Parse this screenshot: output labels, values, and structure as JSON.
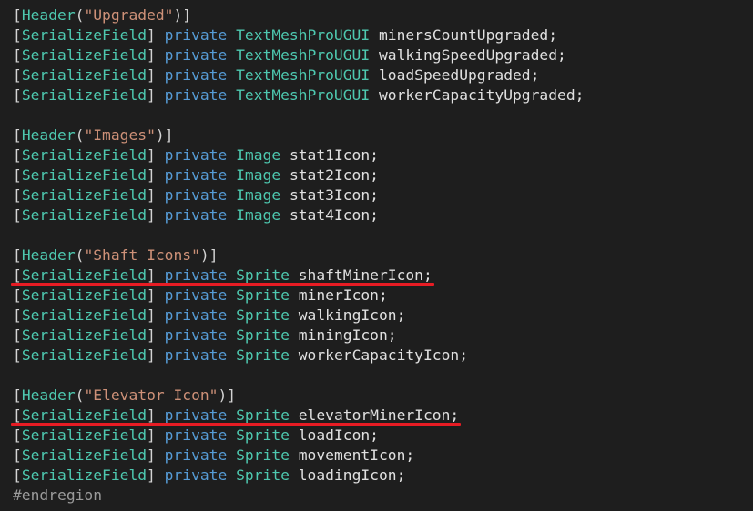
{
  "colors": {
    "background": "#1e1e1e",
    "bracket": "#d4d4d4",
    "attribute": "#4ec9b0",
    "string": "#ce9178",
    "keyword": "#569cd6",
    "type": "#4ec9b0",
    "identifier": "#e0e0e0",
    "preprocessor": "#9b9b9b",
    "underline": "#e81c24"
  },
  "lines": [
    {
      "tokens": [
        [
          "bracket",
          "["
        ],
        [
          "attribute",
          "Header"
        ],
        [
          "bracket",
          "("
        ],
        [
          "string",
          "\"Upgraded\""
        ],
        [
          "bracket",
          ")]"
        ]
      ]
    },
    {
      "tokens": [
        [
          "bracket",
          "["
        ],
        [
          "attribute",
          "SerializeField"
        ],
        [
          "bracket",
          "]"
        ],
        [
          "plain",
          " "
        ],
        [
          "keyword",
          "private"
        ],
        [
          "plain",
          " "
        ],
        [
          "type",
          "TextMeshProUGUI"
        ],
        [
          "plain",
          " "
        ],
        [
          "identifier",
          "minersCountUpgraded;"
        ]
      ]
    },
    {
      "tokens": [
        [
          "bracket",
          "["
        ],
        [
          "attribute",
          "SerializeField"
        ],
        [
          "bracket",
          "]"
        ],
        [
          "plain",
          " "
        ],
        [
          "keyword",
          "private"
        ],
        [
          "plain",
          " "
        ],
        [
          "type",
          "TextMeshProUGUI"
        ],
        [
          "plain",
          " "
        ],
        [
          "identifier",
          "walkingSpeedUpgraded;"
        ]
      ]
    },
    {
      "tokens": [
        [
          "bracket",
          "["
        ],
        [
          "attribute",
          "SerializeField"
        ],
        [
          "bracket",
          "]"
        ],
        [
          "plain",
          " "
        ],
        [
          "keyword",
          "private"
        ],
        [
          "plain",
          " "
        ],
        [
          "type",
          "TextMeshProUGUI"
        ],
        [
          "plain",
          " "
        ],
        [
          "identifier",
          "loadSpeedUpgraded;"
        ]
      ]
    },
    {
      "tokens": [
        [
          "bracket",
          "["
        ],
        [
          "attribute",
          "SerializeField"
        ],
        [
          "bracket",
          "]"
        ],
        [
          "plain",
          " "
        ],
        [
          "keyword",
          "private"
        ],
        [
          "plain",
          " "
        ],
        [
          "type",
          "TextMeshProUGUI"
        ],
        [
          "plain",
          " "
        ],
        [
          "identifier",
          "workerCapacityUpgraded;"
        ]
      ]
    },
    {
      "tokens": []
    },
    {
      "tokens": [
        [
          "bracket",
          "["
        ],
        [
          "attribute",
          "Header"
        ],
        [
          "bracket",
          "("
        ],
        [
          "string",
          "\"Images\""
        ],
        [
          "bracket",
          ")]"
        ]
      ]
    },
    {
      "tokens": [
        [
          "bracket",
          "["
        ],
        [
          "attribute",
          "SerializeField"
        ],
        [
          "bracket",
          "]"
        ],
        [
          "plain",
          " "
        ],
        [
          "keyword",
          "private"
        ],
        [
          "plain",
          " "
        ],
        [
          "type",
          "Image"
        ],
        [
          "plain",
          " "
        ],
        [
          "identifier",
          "stat1Icon;"
        ]
      ]
    },
    {
      "tokens": [
        [
          "bracket",
          "["
        ],
        [
          "attribute",
          "SerializeField"
        ],
        [
          "bracket",
          "]"
        ],
        [
          "plain",
          " "
        ],
        [
          "keyword",
          "private"
        ],
        [
          "plain",
          " "
        ],
        [
          "type",
          "Image"
        ],
        [
          "plain",
          " "
        ],
        [
          "identifier",
          "stat2Icon;"
        ]
      ]
    },
    {
      "tokens": [
        [
          "bracket",
          "["
        ],
        [
          "attribute",
          "SerializeField"
        ],
        [
          "bracket",
          "]"
        ],
        [
          "plain",
          " "
        ],
        [
          "keyword",
          "private"
        ],
        [
          "plain",
          " "
        ],
        [
          "type",
          "Image"
        ],
        [
          "plain",
          " "
        ],
        [
          "identifier",
          "stat3Icon;"
        ]
      ]
    },
    {
      "tokens": [
        [
          "bracket",
          "["
        ],
        [
          "attribute",
          "SerializeField"
        ],
        [
          "bracket",
          "]"
        ],
        [
          "plain",
          " "
        ],
        [
          "keyword",
          "private"
        ],
        [
          "plain",
          " "
        ],
        [
          "type",
          "Image"
        ],
        [
          "plain",
          " "
        ],
        [
          "identifier",
          "stat4Icon;"
        ]
      ]
    },
    {
      "tokens": []
    },
    {
      "tokens": [
        [
          "bracket",
          "["
        ],
        [
          "attribute",
          "Header"
        ],
        [
          "bracket",
          "("
        ],
        [
          "string",
          "\"Shaft Icons\""
        ],
        [
          "bracket",
          ")]"
        ]
      ]
    },
    {
      "tokens": [
        [
          "bracket",
          "["
        ],
        [
          "attribute",
          "SerializeField"
        ],
        [
          "bracket",
          "]"
        ],
        [
          "plain",
          " "
        ],
        [
          "keyword",
          "private"
        ],
        [
          "plain",
          " "
        ],
        [
          "type",
          "Sprite"
        ],
        [
          "plain",
          " "
        ],
        [
          "identifier",
          "shaftMinerIcon;"
        ]
      ],
      "underlined": true
    },
    {
      "tokens": [
        [
          "bracket",
          "["
        ],
        [
          "attribute",
          "SerializeField"
        ],
        [
          "bracket",
          "]"
        ],
        [
          "plain",
          " "
        ],
        [
          "keyword",
          "private"
        ],
        [
          "plain",
          " "
        ],
        [
          "type",
          "Sprite"
        ],
        [
          "plain",
          " "
        ],
        [
          "identifier",
          "minerIcon;"
        ]
      ]
    },
    {
      "tokens": [
        [
          "bracket",
          "["
        ],
        [
          "attribute",
          "SerializeField"
        ],
        [
          "bracket",
          "]"
        ],
        [
          "plain",
          " "
        ],
        [
          "keyword",
          "private"
        ],
        [
          "plain",
          " "
        ],
        [
          "type",
          "Sprite"
        ],
        [
          "plain",
          " "
        ],
        [
          "identifier",
          "walkingIcon;"
        ]
      ]
    },
    {
      "tokens": [
        [
          "bracket",
          "["
        ],
        [
          "attribute",
          "SerializeField"
        ],
        [
          "bracket",
          "]"
        ],
        [
          "plain",
          " "
        ],
        [
          "keyword",
          "private"
        ],
        [
          "plain",
          " "
        ],
        [
          "type",
          "Sprite"
        ],
        [
          "plain",
          " "
        ],
        [
          "identifier",
          "miningIcon;"
        ]
      ]
    },
    {
      "tokens": [
        [
          "bracket",
          "["
        ],
        [
          "attribute",
          "SerializeField"
        ],
        [
          "bracket",
          "]"
        ],
        [
          "plain",
          " "
        ],
        [
          "keyword",
          "private"
        ],
        [
          "plain",
          " "
        ],
        [
          "type",
          "Sprite"
        ],
        [
          "plain",
          " "
        ],
        [
          "identifier",
          "workerCapacityIcon;"
        ]
      ]
    },
    {
      "tokens": []
    },
    {
      "tokens": [
        [
          "bracket",
          "["
        ],
        [
          "attribute",
          "Header"
        ],
        [
          "bracket",
          "("
        ],
        [
          "string",
          "\"Elevator Icon\""
        ],
        [
          "bracket",
          ")]"
        ]
      ]
    },
    {
      "tokens": [
        [
          "bracket",
          "["
        ],
        [
          "attribute",
          "SerializeField"
        ],
        [
          "bracket",
          "]"
        ],
        [
          "plain",
          " "
        ],
        [
          "keyword",
          "private"
        ],
        [
          "plain",
          " "
        ],
        [
          "type",
          "Sprite"
        ],
        [
          "plain",
          " "
        ],
        [
          "identifier",
          "elevatorMinerIcon;"
        ]
      ],
      "underlined": true
    },
    {
      "tokens": [
        [
          "bracket",
          "["
        ],
        [
          "attribute",
          "SerializeField"
        ],
        [
          "bracket",
          "]"
        ],
        [
          "plain",
          " "
        ],
        [
          "keyword",
          "private"
        ],
        [
          "plain",
          " "
        ],
        [
          "type",
          "Sprite"
        ],
        [
          "plain",
          " "
        ],
        [
          "identifier",
          "loadIcon;"
        ]
      ]
    },
    {
      "tokens": [
        [
          "bracket",
          "["
        ],
        [
          "attribute",
          "SerializeField"
        ],
        [
          "bracket",
          "]"
        ],
        [
          "plain",
          " "
        ],
        [
          "keyword",
          "private"
        ],
        [
          "plain",
          " "
        ],
        [
          "type",
          "Sprite"
        ],
        [
          "plain",
          " "
        ],
        [
          "identifier",
          "movementIcon;"
        ]
      ]
    },
    {
      "tokens": [
        [
          "bracket",
          "["
        ],
        [
          "attribute",
          "SerializeField"
        ],
        [
          "bracket",
          "]"
        ],
        [
          "plain",
          " "
        ],
        [
          "keyword",
          "private"
        ],
        [
          "plain",
          " "
        ],
        [
          "type",
          "Sprite"
        ],
        [
          "plain",
          " "
        ],
        [
          "identifier",
          "loadingIcon;"
        ]
      ]
    },
    {
      "tokens": [
        [
          "preprocessor",
          "#endregion"
        ]
      ]
    }
  ]
}
